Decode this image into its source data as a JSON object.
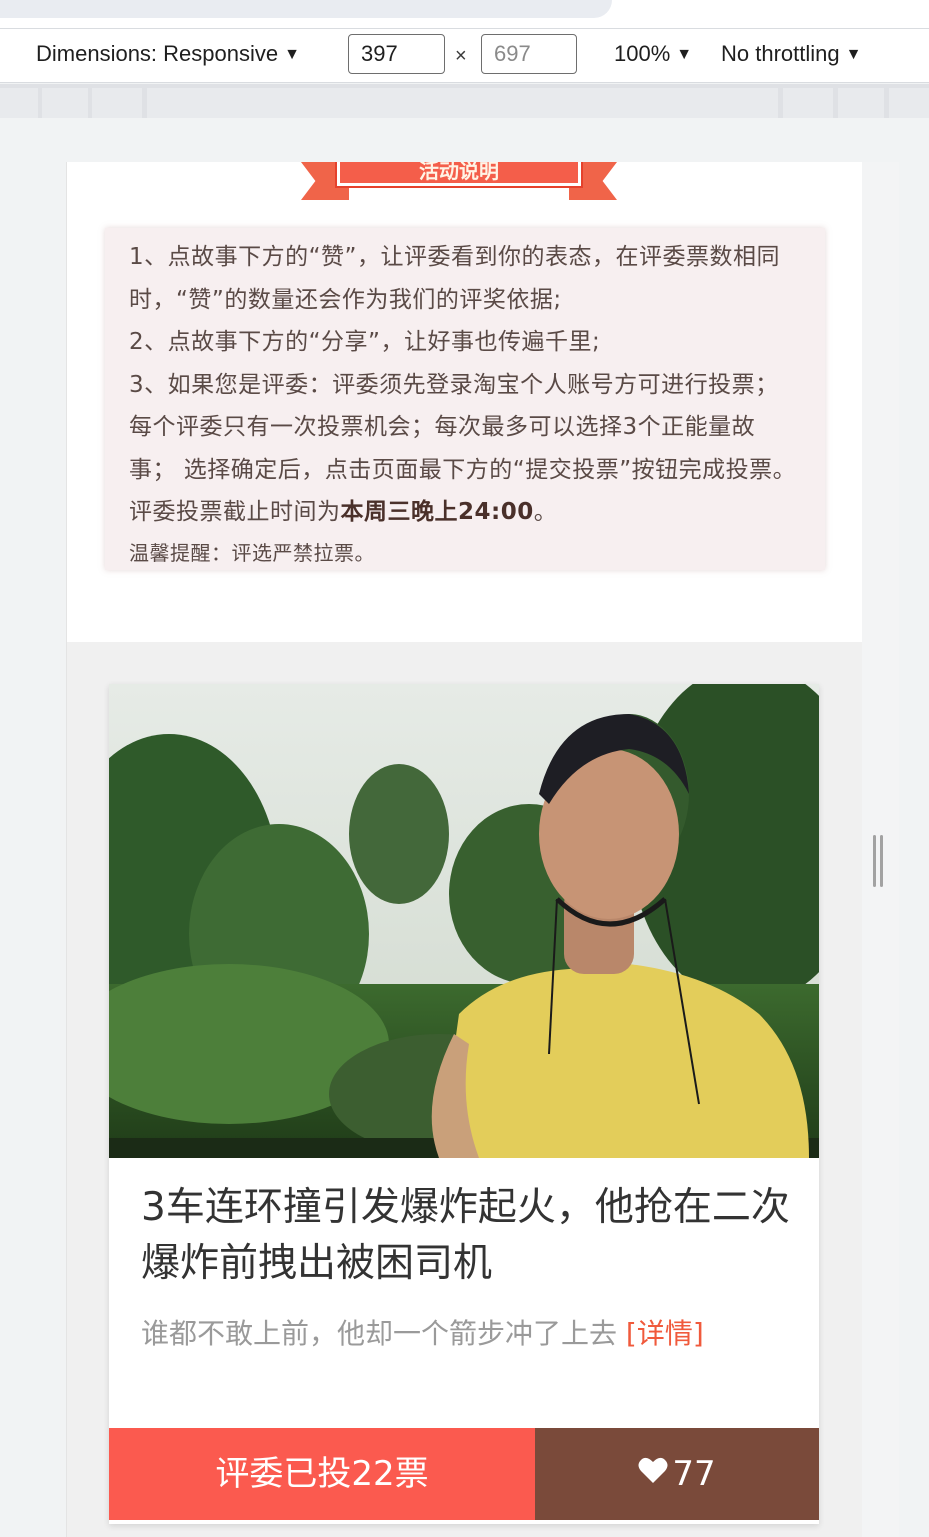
{
  "devtools": {
    "dimensions_label": "Dimensions: Responsive",
    "width_value": "397",
    "height_placeholder": "697",
    "times_sign": "×",
    "zoom": "100%",
    "throttling": "No throttling",
    "caret": "▼"
  },
  "rules": {
    "ribbon_title": "活动说明",
    "line1": "1、点故事下方的“赞”，让评委看到你的表态，在评委票数相同时，“赞”的数量还会作为我们的评奖依据;",
    "line2": "2、点故事下方的“分享”，让好事也传遍千里;",
    "line3_a": "3、如果您是评委：评委须先登录淘宝个人账号方可进行投票；每个评委只有一次投票机会；每次最多可以选择3个正能量故事；  选择确定后，点击页面最下方的“提交投票”按钮完成投票。评委投票截止时间为",
    "line3_strong": "本周三晚上24:00",
    "line3_end": "。",
    "tip": "温馨提醒：评选严禁拉票。"
  },
  "story": {
    "title": "3车连环撞引发爆炸起火，他抢在二次爆炸前拽出被困司机",
    "subtitle": "谁都不敢上前，他却一个箭步冲了上去 ",
    "detail_link": "[详情]",
    "vote_label": "评委已投22票",
    "likes": "77",
    "colors": {
      "vote": "#fb5a4f",
      "like": "#7a4a3a",
      "link": "#f05a3c"
    }
  }
}
